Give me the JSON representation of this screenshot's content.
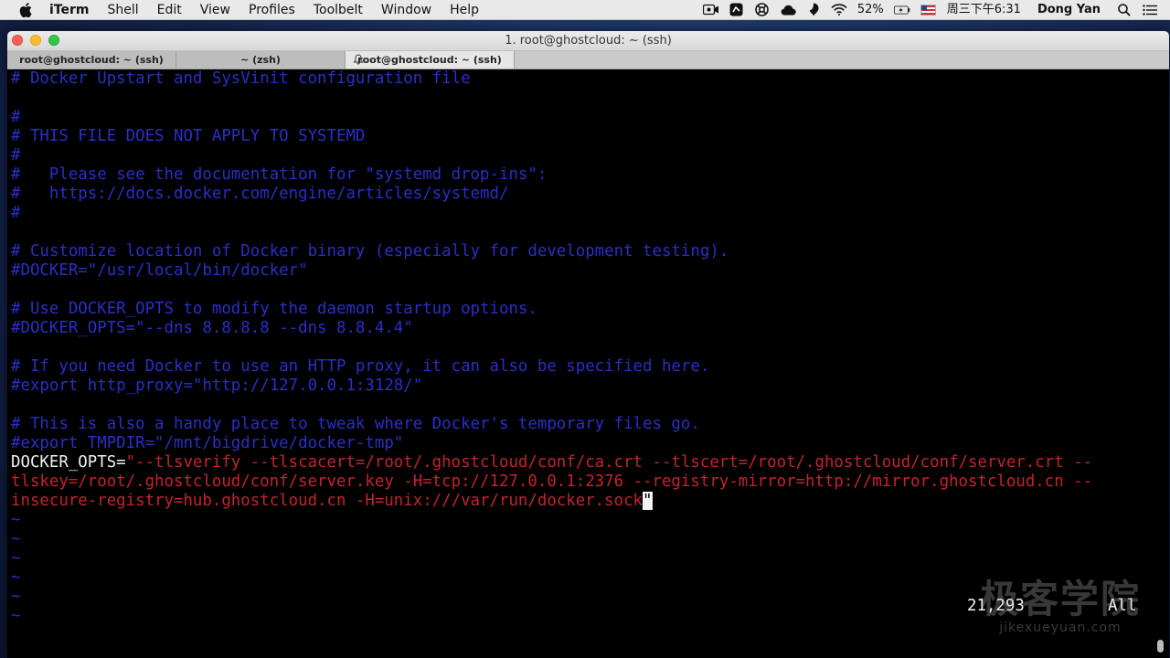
{
  "menubar": {
    "app_name": "iTerm",
    "items": [
      "Shell",
      "Edit",
      "View",
      "Profiles",
      "Toolbelt",
      "Window",
      "Help"
    ],
    "battery": "52%",
    "clock": "周三下午6:31",
    "user": "Dong Yan"
  },
  "window": {
    "title": "1. root@ghostcloud: ~ (ssh)",
    "tabs": [
      {
        "label": "root@ghostcloud: ~ (ssh)"
      },
      {
        "label": "~ (zsh)"
      },
      {
        "label": "root@ghostcloud: ~ (ssh)"
      }
    ]
  },
  "terminal": {
    "lines": [
      {
        "type": "comment",
        "text": "# Docker Upstart and SysVinit configuration file"
      },
      {
        "type": "blank",
        "text": ""
      },
      {
        "type": "comment",
        "text": "#"
      },
      {
        "type": "comment",
        "text": "# THIS FILE DOES NOT APPLY TO SYSTEMD"
      },
      {
        "type": "comment",
        "text": "#"
      },
      {
        "type": "comment",
        "text": "#   Please see the documentation for \"systemd drop-ins\":"
      },
      {
        "type": "comment",
        "text": "#   https://docs.docker.com/engine/articles/systemd/"
      },
      {
        "type": "comment",
        "text": "#"
      },
      {
        "type": "blank",
        "text": ""
      },
      {
        "type": "comment",
        "text": "# Customize location of Docker binary (especially for development testing)."
      },
      {
        "type": "comment",
        "text": "#DOCKER=\"/usr/local/bin/docker\""
      },
      {
        "type": "blank",
        "text": ""
      },
      {
        "type": "comment",
        "text": "# Use DOCKER_OPTS to modify the daemon startup options."
      },
      {
        "type": "comment",
        "text": "#DOCKER_OPTS=\"--dns 8.8.8.8 --dns 8.8.4.4\""
      },
      {
        "type": "blank",
        "text": ""
      },
      {
        "type": "comment",
        "text": "# If you need Docker to use an HTTP proxy, it can also be specified here."
      },
      {
        "type": "comment",
        "text": "#export http_proxy=\"http://127.0.0.1:3128/\""
      },
      {
        "type": "blank",
        "text": ""
      },
      {
        "type": "comment",
        "text": "# This is also a handy place to tweak where Docker's temporary files go."
      },
      {
        "type": "comment",
        "text": "#export TMPDIR=\"/mnt/bigdrive/docker-tmp\""
      },
      {
        "type": "opts1",
        "key": "DOCKER_OPTS=",
        "text": "\"--tlsverify --tlscacert=/root/.ghostcloud/conf/ca.crt --tlscert=/root/.ghostcloud/conf/server.crt --"
      },
      {
        "type": "red",
        "text": "tlskey=/root/.ghostcloud/conf/server.key -H=tcp://127.0.0.1:2376 --registry-mirror=http://mirror.ghostcloud.cn --"
      },
      {
        "type": "cursorline",
        "text": "insecure-registry=hub.ghostcloud.cn -H=unix:///var/run/docker.sock",
        "cursor": "\""
      },
      {
        "type": "tilde",
        "text": "~"
      },
      {
        "type": "tilde",
        "text": "~"
      },
      {
        "type": "tilde",
        "text": "~"
      },
      {
        "type": "tilde",
        "text": "~"
      },
      {
        "type": "tilde",
        "text": "~"
      },
      {
        "type": "tilde",
        "text": "~"
      }
    ],
    "ruler_position": "21,293",
    "ruler_scroll": "All"
  },
  "watermark": {
    "title": "极客学院",
    "url": "jikexueyuan.com"
  }
}
